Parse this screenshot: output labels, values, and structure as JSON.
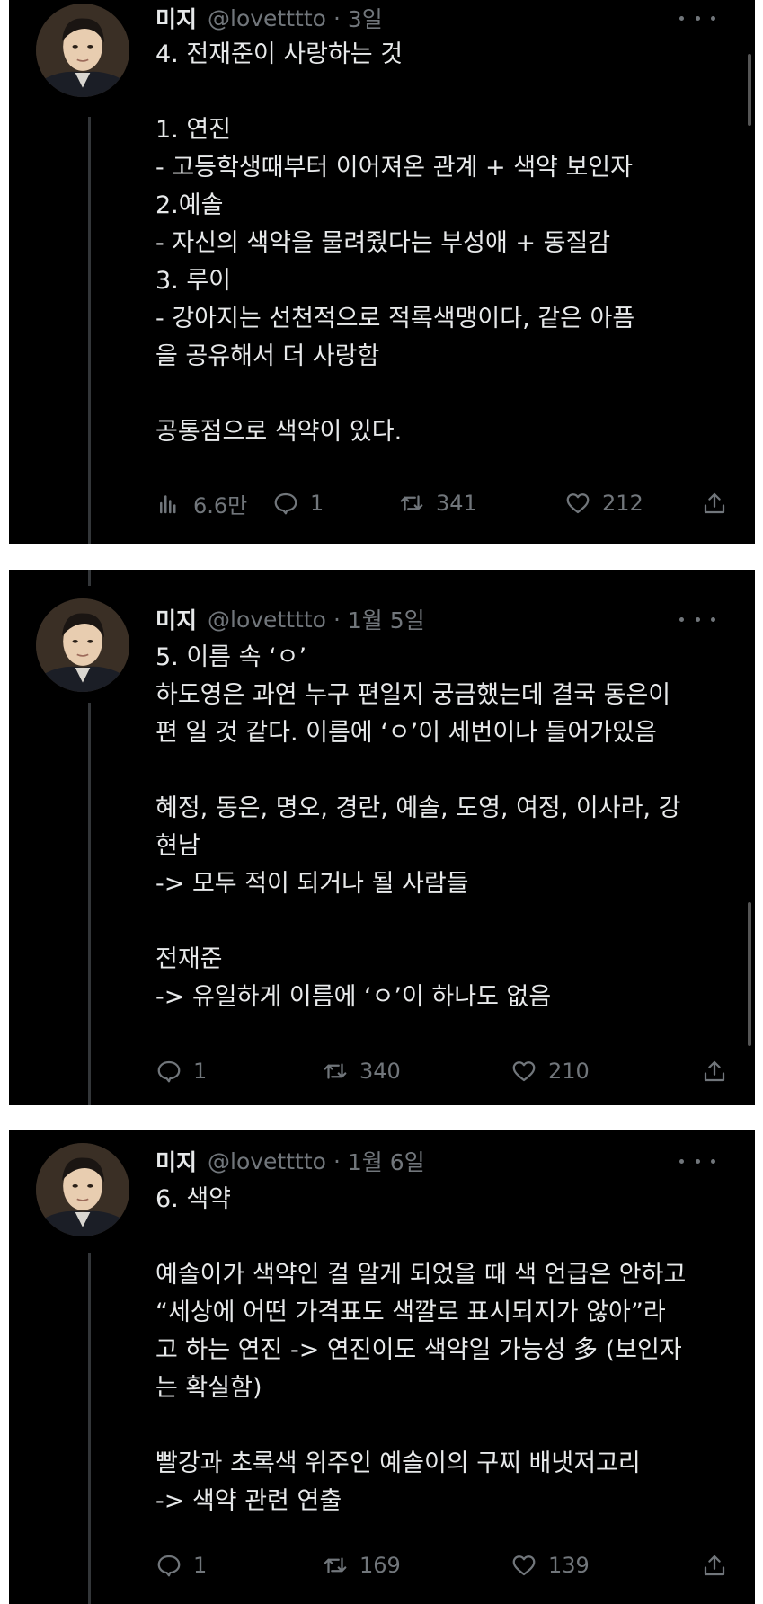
{
  "tweets": [
    {
      "name": "미지",
      "handle": "@lovetttto",
      "separator": "·",
      "time": "3일",
      "text": "4. 전재준이 사랑하는 것\n\n1. 연진\n- 고등학생때부터 이어져온 관계 + 색약 보인자\n2.예솔\n- 자신의 색약을 물려줬다는 부성애 + 동질감\n3. 루이\n- 강아지는 선천적으로 적록색맹이다, 같은 아픔\n을 공유해서 더 사랑함\n\n공통점으로 색약이 있다.",
      "views": "6.6만",
      "replies": "1",
      "retweets": "341",
      "likes": "212"
    },
    {
      "name": "미지",
      "handle": "@lovetttto",
      "separator": "·",
      "time": "1월 5일",
      "text": "5. 이름 속 ‘ㅇ’\n하도영은 과연 누구 편일지 궁금했는데 결국 동은이\n편 일 것 같다. 이름에 ‘ㅇ’이 세번이나 들어가있음\n\n혜정, 동은, 명오, 경란, 예솔, 도영, 여정, 이사라, 강\n현남\n-> 모두 적이 되거나 될 사람들\n\n전재준\n-> 유일하게 이름에 ‘ㅇ’이 하나도 없음",
      "replies": "1",
      "retweets": "340",
      "likes": "210"
    },
    {
      "name": "미지",
      "handle": "@lovetttto",
      "separator": "·",
      "time": "1월 6일",
      "text": "6. 색약\n\n예솔이가 색약인 걸 알게 되었을 때 색 언급은 안하고\n“세상에 어떤 가격표도 색깔로 표시되지가 않아”라\n고 하는 연진 -> 연진이도 색약일 가능성 多 (보인자\n는 확실함)\n\n빨강과 초록색 위주인 예솔이의 구찌 배냇저고리\n-> 색약 관련 연출",
      "replies": "1",
      "retweets": "169",
      "likes": "139"
    }
  ],
  "icons": {
    "views": "bar-chart-icon",
    "reply": "speech-bubble-icon",
    "retweet": "retweet-arrows-icon",
    "like": "heart-icon",
    "share": "share-upload-icon",
    "more": "more-dots-icon"
  },
  "colors": {
    "background": "#000000",
    "text": "#e7e9ea",
    "muted": "#71767b",
    "thread_line": "#333639"
  }
}
